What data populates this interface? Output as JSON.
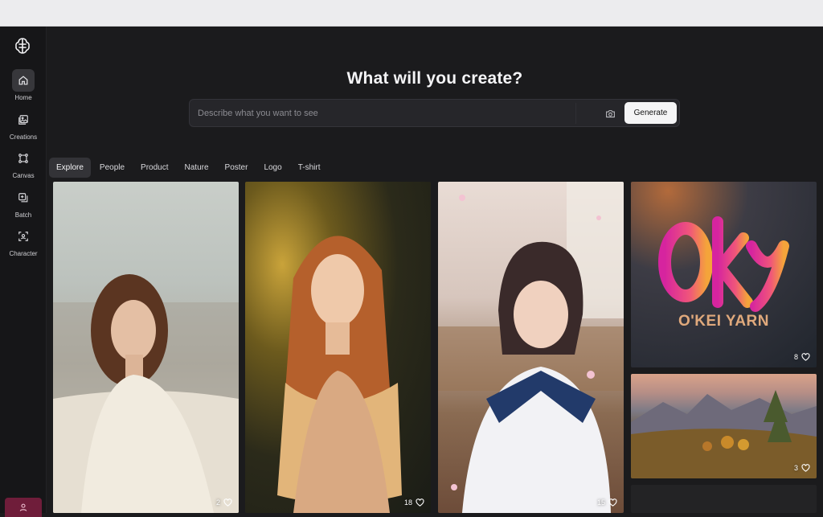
{
  "sidebar": {
    "items": [
      {
        "label": "Home",
        "icon": "home-icon",
        "active": true
      },
      {
        "label": "Creations",
        "icon": "gallery-icon",
        "active": false
      },
      {
        "label": "Canvas",
        "icon": "canvas-icon",
        "active": false
      },
      {
        "label": "Batch",
        "icon": "batch-icon",
        "active": false
      },
      {
        "label": "Character",
        "icon": "character-icon",
        "active": false
      }
    ]
  },
  "hero": {
    "title": "What will you create?",
    "search_placeholder": "Describe what you want to see",
    "generate_label": "Generate"
  },
  "tabs": [
    "Explore",
    "People",
    "Product",
    "Nature",
    "Poster",
    "Logo",
    "T-shirt"
  ],
  "gallery": [
    {
      "likes": "2",
      "subject": "curly-haired woman in white blouse"
    },
    {
      "likes": "18",
      "subject": "woman with long red hair"
    },
    {
      "likes": "15",
      "subject": "girl in school uniform with cherry blossoms"
    },
    {
      "likes": "8",
      "subject": "O'KEI YARN logo",
      "logo_text": "O'KEI YARN"
    },
    {
      "likes": "3",
      "subject": "mountain landscape in autumn"
    }
  ],
  "colors": {
    "background": "#1b1b1d",
    "sidebar": "#161618",
    "accent_user": "#6f1d3a",
    "logo_magenta": "#d6249f",
    "logo_orange": "#f4a43a"
  }
}
